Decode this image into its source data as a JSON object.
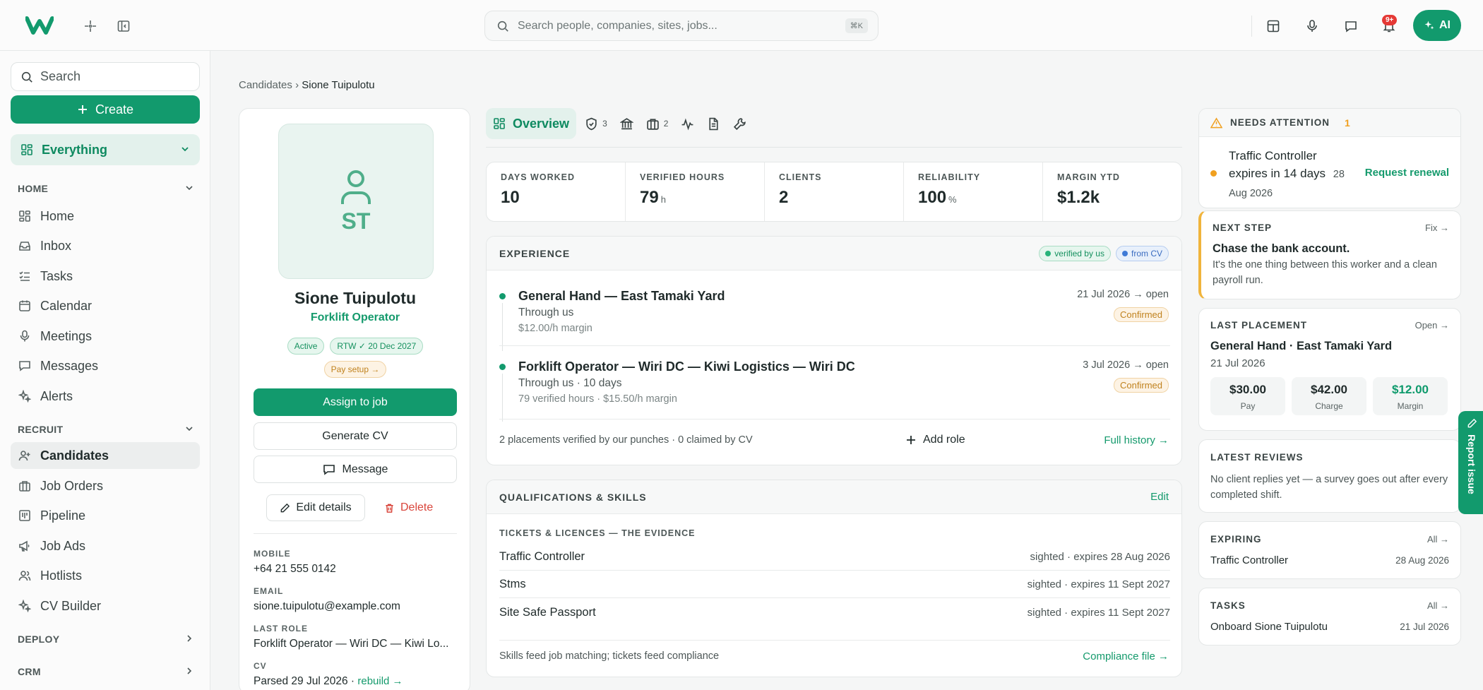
{
  "topbar": {
    "search_placeholder": "Search people, companies, sites, jobs...",
    "shortcut": "⌘K",
    "notif_count": "9+",
    "ai_label": "AI"
  },
  "sidebar": {
    "search_label": "Search",
    "create_label": "Create",
    "workspace_label": "Everything",
    "home_section": "HOME",
    "home_items": [
      "Home",
      "Inbox",
      "Tasks",
      "Calendar",
      "Meetings",
      "Messages",
      "Alerts"
    ],
    "recruit_section": "RECRUIT",
    "recruit_items": [
      "Candidates",
      "Job Orders",
      "Pipeline",
      "Job Ads",
      "Hotlists",
      "CV Builder"
    ],
    "deploy_section": "DEPLOY",
    "crm_section": "CRM"
  },
  "breadcrumb": {
    "parent": "Candidates",
    "sep": "›",
    "current": "Sione Tuipulotu"
  },
  "profile": {
    "initials": "ST",
    "name": "Sione Tuipulotu",
    "role": "Forklift Operator",
    "pills": [
      "Active",
      "RTW ✓ 20 Dec 2027",
      "Pay setup →"
    ],
    "assign_label": "Assign to job",
    "cv_label": "Generate CV",
    "message_label": "Message",
    "edit_label": "Edit details",
    "delete_label": "Delete",
    "mobile_label": "MOBILE",
    "mobile": "+64 21 555 0142",
    "email_label": "EMAIL",
    "email": "sione.tuipulotu@example.com",
    "last_role_label": "LAST ROLE",
    "last_role": "Forklift Operator — Wiri DC — Kiwi Lo...",
    "cv_field_label": "CV",
    "cv_parsed": "Parsed 29 Jul 2026 ·",
    "cv_rebuild": "rebuild →"
  },
  "tabs": {
    "overview": "Overview",
    "compliance_count": "3",
    "jobs_count": "2"
  },
  "stats": [
    {
      "label": "DAYS WORKED",
      "value": "10",
      "unit": ""
    },
    {
      "label": "VERIFIED HOURS",
      "value": "79",
      "unit": "h"
    },
    {
      "label": "CLIENTS",
      "value": "2",
      "unit": ""
    },
    {
      "label": "RELIABILITY",
      "value": "100",
      "unit": "%"
    },
    {
      "label": "MARGIN YTD",
      "value": "$1.2k",
      "unit": ""
    }
  ],
  "experience": {
    "title": "EXPERIENCE",
    "tag_verified": "verified by us",
    "tag_cv": "from CV",
    "items": [
      {
        "title": "General Hand — East Tamaki Yard",
        "sub": "Through us",
        "meta": "$12.00/h margin",
        "date": "21 Jul 2026 → open",
        "status": "Confirmed"
      },
      {
        "title": "Forklift Operator — Wiri DC — Kiwi Logistics — Wiri DC",
        "sub": "Through us · 10 days",
        "meta": "79 verified hours · $15.50/h margin",
        "date": "3 Jul 2026 → open",
        "status": "Confirmed"
      }
    ],
    "footer": "2 placements verified by our punches · 0 claimed by CV",
    "add_role": "Add role",
    "full_history": "Full history →"
  },
  "qualifications": {
    "title": "QUALIFICATIONS & SKILLS",
    "edit": "Edit",
    "subtitle": "TICKETS & LICENCES — THE EVIDENCE",
    "rows": [
      {
        "name": "Traffic Controller",
        "status": "sighted · expires 28 Aug 2026"
      },
      {
        "name": "Stms",
        "status": "sighted · expires 11 Sept 2027"
      },
      {
        "name": "Site Safe Passport",
        "status": "sighted · expires 11 Sept 2027"
      }
    ],
    "footer": "Skills feed job matching; tickets feed compliance",
    "compliance_link": "Compliance file →"
  },
  "right": {
    "attention_title": "NEEDS ATTENTION",
    "attention_count": "1",
    "attention_text": "Traffic Controller expires in 14 days",
    "attention_date": "28 Aug 2026",
    "attention_action": "Request renewal",
    "next_step_title": "NEXT STEP",
    "next_step_link": "Fix →",
    "next_step_head": "Chase the bank account.",
    "next_step_body": "It's the one thing between this worker and a clean payroll run.",
    "last_placement_title": "LAST PLACEMENT",
    "last_placement_link": "Open →",
    "last_placement_name": "General Hand · East Tamaki Yard",
    "last_placement_date": "21 Jul 2026",
    "amounts": [
      {
        "value": "$30.00",
        "label": "Pay"
      },
      {
        "value": "$42.00",
        "label": "Charge"
      },
      {
        "value": "$12.00",
        "label": "Margin"
      }
    ],
    "reviews_title": "LATEST REVIEWS",
    "reviews_text": "No client replies yet — a survey goes out after every completed shift.",
    "expiring_title": "EXPIRING",
    "expiring_link": "All →",
    "expiring_item": "Traffic Controller",
    "expiring_date": "28 Aug 2026",
    "tasks_title": "TASKS",
    "tasks_link": "All →",
    "tasks_item": "Onboard Sione Tuipulotu",
    "tasks_date": "21 Jul 2026",
    "report_label": "Report issue"
  },
  "colors": {
    "brand": "#129a6d",
    "warning": "#f0a020",
    "danger": "#d9453b"
  }
}
